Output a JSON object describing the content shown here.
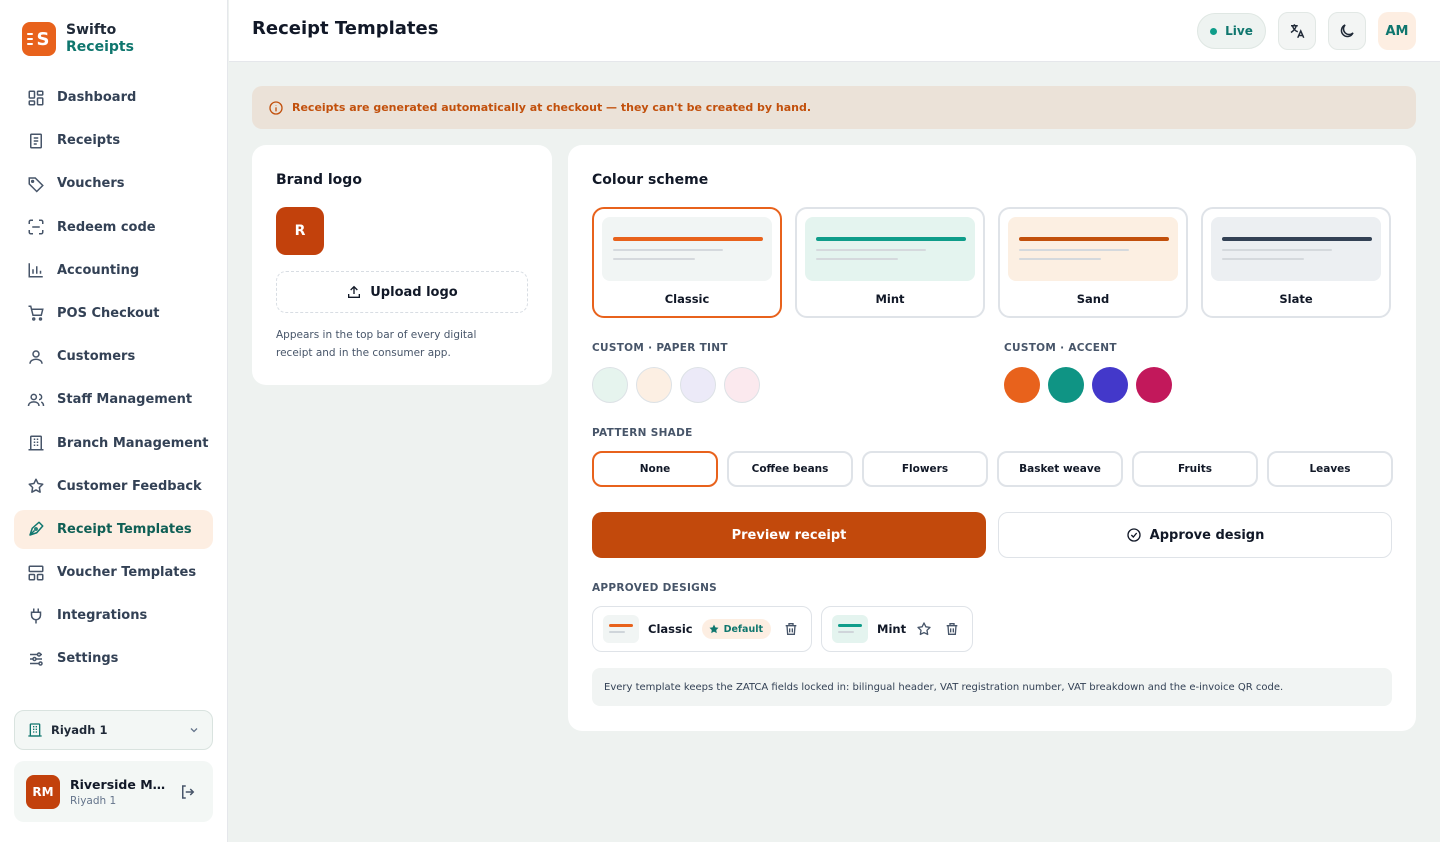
{
  "app": {
    "name_line1": "Swifto",
    "name_line2": "Receipts",
    "logo_letter": "S"
  },
  "sidebar": {
    "items": [
      {
        "label": "Dashboard",
        "icon": "dashboard-icon"
      },
      {
        "label": "Receipts",
        "icon": "receipt-icon"
      },
      {
        "label": "Vouchers",
        "icon": "tag-icon"
      },
      {
        "label": "Redeem code",
        "icon": "scan-icon"
      },
      {
        "label": "Accounting",
        "icon": "bar-chart-icon"
      },
      {
        "label": "POS Checkout",
        "icon": "cart-icon"
      },
      {
        "label": "Customers",
        "icon": "user-icon"
      },
      {
        "label": "Staff Management",
        "icon": "users-icon"
      },
      {
        "label": "Branch Management",
        "icon": "building-icon"
      },
      {
        "label": "Customer Feedback",
        "icon": "star-icon"
      },
      {
        "label": "Receipt Templates",
        "icon": "brush-icon",
        "active": true
      },
      {
        "label": "Voucher Templates",
        "icon": "layout-icon"
      },
      {
        "label": "Integrations",
        "icon": "plug-icon"
      },
      {
        "label": "Settings",
        "icon": "sliders-icon"
      }
    ],
    "branch": "Riyadh 1",
    "user": {
      "initials": "RM",
      "name": "Riverside Ma...",
      "branch": "Riyadh 1"
    }
  },
  "header": {
    "title": "Receipt Templates",
    "status": "Live",
    "avatar_initials": "AM"
  },
  "banner": {
    "text": "Receipts are generated automatically at checkout — they can't be created by hand."
  },
  "brand_logo": {
    "title": "Brand logo",
    "preview_letter": "R",
    "upload_label": "Upload logo",
    "help": "Appears in the top bar of every digital receipt and in the consumer app."
  },
  "colour_scheme": {
    "title": "Colour scheme",
    "schemes": [
      {
        "name": "Classic",
        "accent": "#e8621c",
        "bg": "#f1f5f4",
        "selected": true
      },
      {
        "name": "Mint",
        "accent": "#0f9d8a",
        "bg": "#e4f4ef",
        "selected": false
      },
      {
        "name": "Sand",
        "accent": "#c2500c",
        "bg": "#fcefe2",
        "selected": false
      },
      {
        "name": "Slate",
        "accent": "#334155",
        "bg": "#eceff2",
        "selected": false
      }
    ],
    "paper_tint_label": "CUSTOM · PAPER TINT",
    "paper_tints": [
      "#e6f4ee",
      "#fcefe3",
      "#eceaf8",
      "#fbe9ee"
    ],
    "accent_label": "CUSTOM · ACCENT",
    "accents": [
      "#e8621c",
      "#0f9484",
      "#4338ca",
      "#c2185b"
    ],
    "pattern_label": "PATTERN SHADE",
    "patterns": [
      {
        "name": "None",
        "selected": true
      },
      {
        "name": "Coffee beans",
        "selected": false
      },
      {
        "name": "Flowers",
        "selected": false
      },
      {
        "name": "Basket weave",
        "selected": false
      },
      {
        "name": "Fruits",
        "selected": false
      },
      {
        "name": "Leaves",
        "selected": false
      }
    ],
    "preview_button": "Preview receipt",
    "approve_button": "Approve design",
    "approved_label": "APPROVED DESIGNS",
    "approved": [
      {
        "name": "Classic",
        "badge": "Default",
        "accent": "#e8621c",
        "bg": "#f1f5f4"
      },
      {
        "name": "Mint",
        "badge": "",
        "accent": "#0f9d8a",
        "bg": "#e4f4ef"
      }
    ],
    "note": "Every template keeps the ZATCA fields locked in: bilingual header, VAT registration number, VAT breakdown and the e-invoice QR code."
  }
}
